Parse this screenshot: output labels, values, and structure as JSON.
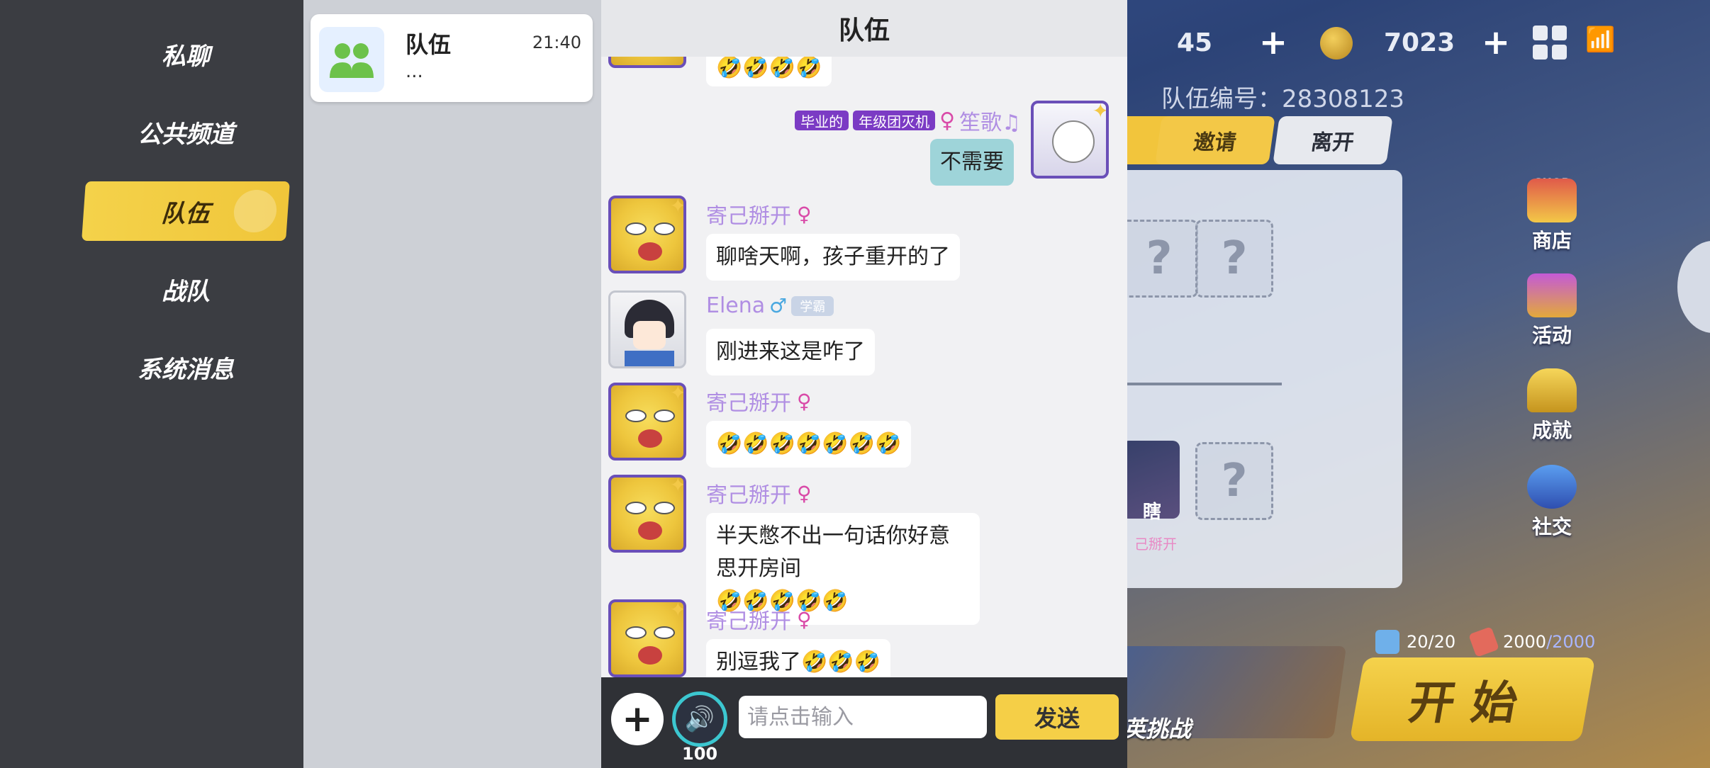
{
  "lobby": {
    "stat_left": "45",
    "coins": "7023",
    "team_id": "队伍编号：28308123",
    "tabs": {
      "invite": "邀请",
      "leave": "离开"
    },
    "empty_slot": "?",
    "member_tag": "瞎",
    "member_name": "己掰开",
    "side": {
      "shop_tag": "SHOP",
      "shop": "商店",
      "event": "活动",
      "achievement": "成就",
      "social": "社交"
    },
    "resources": {
      "tickets": "20/20",
      "energy": "2000",
      "energy_max": "/2000"
    },
    "mode_label": "英挑战",
    "start": "开始"
  },
  "nav": {
    "items": [
      {
        "label": "私聊"
      },
      {
        "label": "公共频道"
      },
      {
        "label": "队伍"
      },
      {
        "label": "战队"
      },
      {
        "label": "系统消息"
      }
    ]
  },
  "conversations": [
    {
      "title": "队伍",
      "time": "21:40",
      "preview": "..."
    }
  ],
  "chat": {
    "title": "队伍",
    "self": {
      "badges": [
        "毕业的",
        "年级团灭机"
      ],
      "gender": "♀",
      "name": "笙歌♫",
      "message": "不需要"
    },
    "top_partial_message": "🤣🤣🤣🤣",
    "messages": [
      {
        "name": "寄己掰开",
        "gender": "♀",
        "text": "聊啥天啊，孩子重开的了"
      },
      {
        "name": "Elena",
        "gender": "♂",
        "badge": "学霸",
        "text": "刚进来这是咋了"
      },
      {
        "name": "寄己掰开",
        "gender": "♀",
        "text": "🤣🤣🤣🤣🤣🤣🤣"
      },
      {
        "name": "寄己掰开",
        "gender": "♀",
        "text": "半天憋不出一句话你好意思开房间",
        "text2": "🤣🤣🤣🤣🤣"
      },
      {
        "name": "寄己掰开",
        "gender": "♀",
        "text": "别逗我了🤣🤣🤣"
      }
    ]
  },
  "input": {
    "placeholder": "请点击输入",
    "voice_count": "100",
    "send_label": "发送"
  }
}
